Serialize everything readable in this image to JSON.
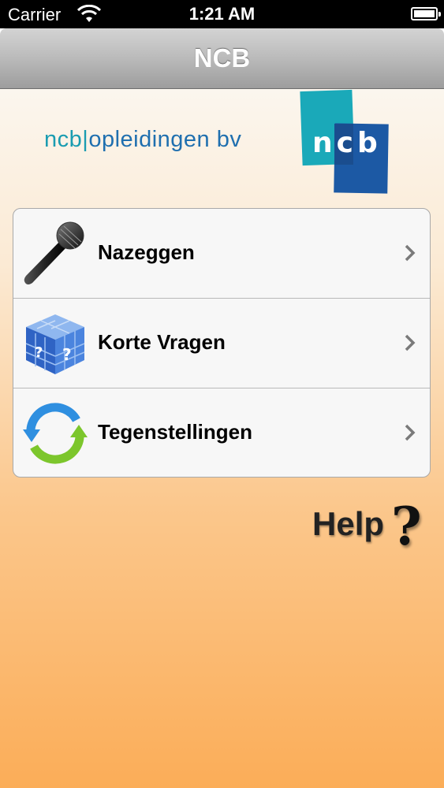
{
  "status_bar": {
    "carrier": "Carrier",
    "time": "1:21 AM"
  },
  "nav": {
    "title": "NCB"
  },
  "logo": {
    "text_ncb": "ncb",
    "text_separator": "|",
    "text_rest": "opleidingen bv",
    "mark_letters": "ncb"
  },
  "menu": {
    "items": [
      {
        "label": "Nazeggen",
        "icon": "microphone-icon"
      },
      {
        "label": "Korte Vragen",
        "icon": "question-cube-icon"
      },
      {
        "label": "Tegenstellingen",
        "icon": "refresh-arrows-icon"
      }
    ]
  },
  "help": {
    "label": "Help",
    "mark": "?"
  },
  "colors": {
    "nav_text": "#ffffff",
    "logo_teal": "#1aa9b9",
    "logo_blue": "#1c59a4",
    "background_bottom": "#fbad58"
  }
}
